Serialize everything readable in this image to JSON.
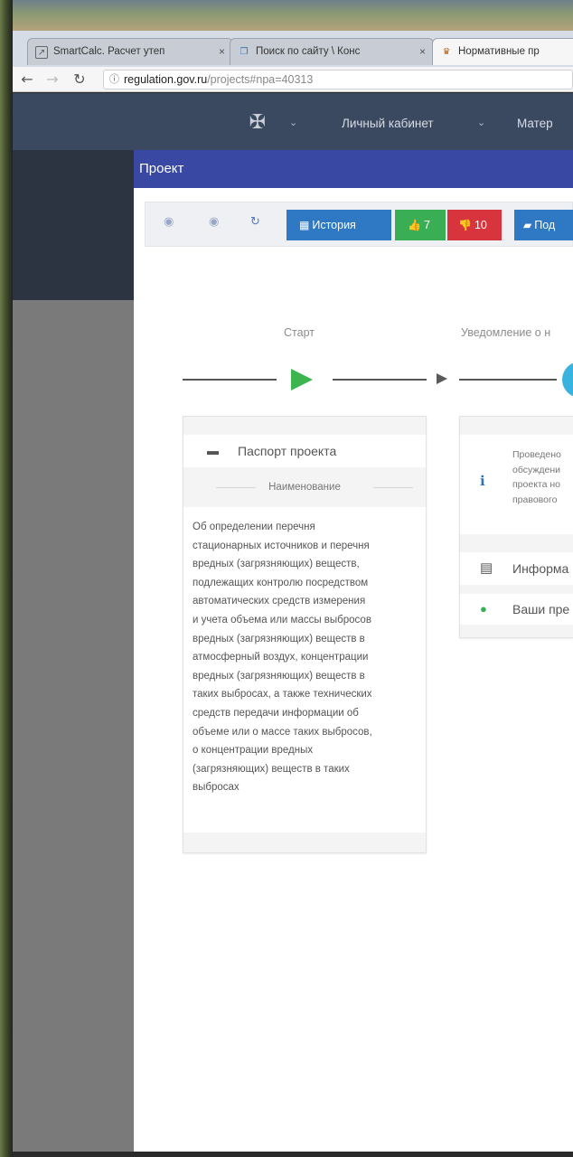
{
  "browser": {
    "tabs": [
      {
        "label": "SmartCalc. Расчет утеп",
        "icon": "smartcalc-icon"
      },
      {
        "label": "Поиск по сайту \\ Конс",
        "icon": "consultant-icon"
      },
      {
        "label": "Нормативные пр",
        "icon": "gov-icon",
        "active": true
      }
    ],
    "close_glyph": "×",
    "address": {
      "host": "regulation.gov.ru",
      "path": "/projects#npa=40313"
    }
  },
  "header": {
    "emblem_icon": "coat-of-arms-icon",
    "links": [
      "Личный кабинет",
      "Матер"
    ],
    "chevron": "⌄"
  },
  "project_bar": {
    "title": "Проект"
  },
  "toolbar": {
    "history": "История",
    "likes": "7",
    "dislikes": "10",
    "subscribe": "Под",
    "colors": {
      "history": "#2f78c4",
      "likes": "#3aae54",
      "dislikes": "#d7343d",
      "subscribe": "#2f78c4"
    }
  },
  "stages": [
    {
      "label": "Старт",
      "state": "done"
    },
    {
      "label": "Уведомление о н",
      "state": "current"
    }
  ],
  "passport": {
    "title": "Паспорт проекта",
    "subtitle": "Наименование",
    "lines": [
      "Об определении перечня",
      "стационарных источников и перечня",
      "вредных (загрязняющих) веществ,",
      "подлежащих контролю посредством",
      "автоматических средств измерения",
      "и учета объема или массы выбросов",
      "вредных (загрязняющих) веществ в",
      "атмосферный воздух, концентрации",
      "вредных (загрязняющих) веществ в",
      "таких выбросах, а также технических",
      "средств передачи информации об",
      "объеме или о массе таких выбросов,",
      "о концентрации вредных",
      "(загрязняющих) веществ в таких",
      "выбросах"
    ]
  },
  "stage_card": {
    "note_lines": [
      "Проведено",
      "обсуждени",
      "проекта но",
      "правового"
    ],
    "info_label": "Информа",
    "comments_label": "Ваши пре"
  }
}
